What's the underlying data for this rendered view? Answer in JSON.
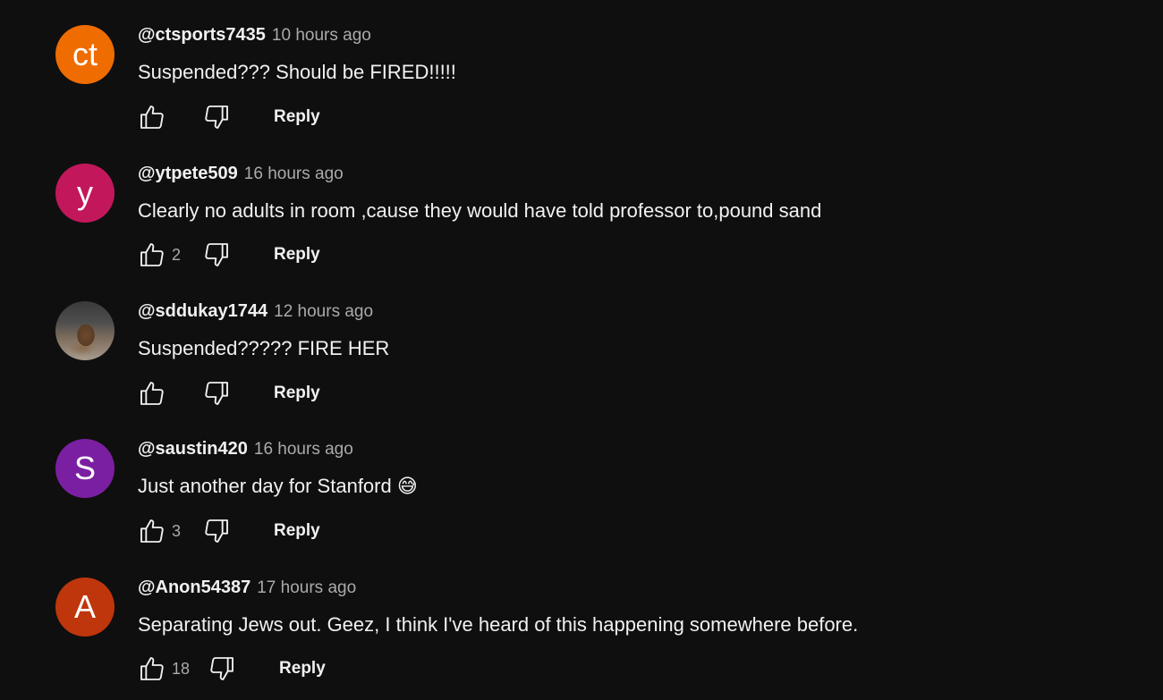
{
  "comments": [
    {
      "avatar_text": "ct",
      "avatar_color": "#ef6c00",
      "author": "@ctsports7435",
      "time": "10 hours ago",
      "text": "Suspended???  Should be FIRED!!!!!",
      "likes": "",
      "reply_label": "Reply"
    },
    {
      "avatar_text": "y",
      "avatar_color": "#c2185b",
      "author": "@ytpete509",
      "time": "16 hours ago",
      "text": "Clearly no adults in room ,cause they would have told professor to,pound sand",
      "likes": "2",
      "reply_label": "Reply"
    },
    {
      "avatar_text": "",
      "avatar_color": "",
      "author": "@sddukay1744",
      "time": "12 hours ago",
      "text": "Suspended?????  FIRE HER",
      "likes": "",
      "reply_label": "Reply"
    },
    {
      "avatar_text": "S",
      "avatar_color": "#7b1fa2",
      "author": "@saustin420",
      "time": "16 hours ago",
      "text": "Just another day for Stanford 😅",
      "likes": "3",
      "reply_label": "Reply"
    },
    {
      "avatar_text": "A",
      "avatar_color": "#bf360c",
      "author": "@Anon54387",
      "time": "17 hours ago",
      "text": "Separating Jews out.  Geez, I think I've heard of this happening somewhere before.",
      "likes": "18",
      "reply_label": "Reply"
    }
  ],
  "icons": {
    "like": "thumbs-up-icon",
    "dislike": "thumbs-down-icon"
  },
  "theme": {
    "background": "#0f0f0f",
    "text": "#f1f1f1",
    "secondary_text": "#aaaaaa"
  }
}
